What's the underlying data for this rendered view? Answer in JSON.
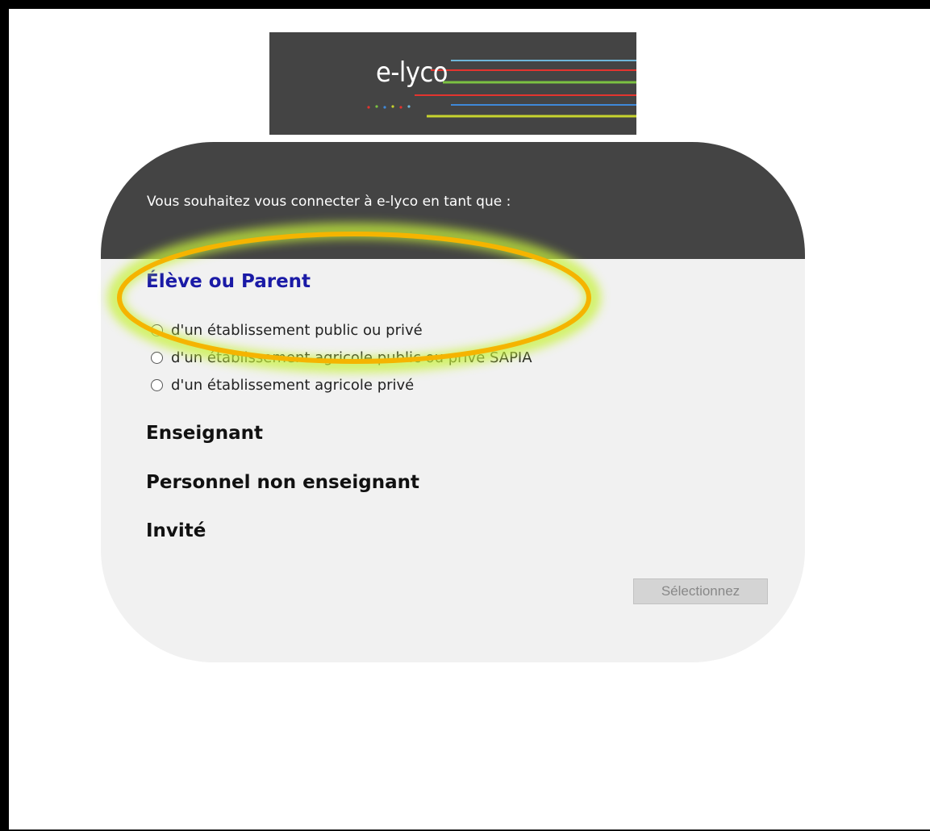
{
  "logo": {
    "text": "e-lyco",
    "stripe_colors": [
      "#6fb6d9",
      "#e3342f",
      "#7bc142",
      "#3f88d8",
      "#c7d32e"
    ]
  },
  "header": {
    "prompt": "Vous souhaitez vous connecter à e-lyco en tant que :"
  },
  "sections": {
    "eleve_parent": "Élève ou Parent",
    "enseignant": "Enseignant",
    "personnel": "Personnel non enseignant",
    "invite": "Invité"
  },
  "options": [
    {
      "label": "d'un établissement public ou privé"
    },
    {
      "label": "d'un établissement agricole public ou privé SAPIA"
    },
    {
      "label": "d'un établissement agricole privé"
    }
  ],
  "button": {
    "label": "Sélectionnez"
  },
  "annotation": {
    "color": "#f5b400",
    "glow": "#c8f23a"
  }
}
